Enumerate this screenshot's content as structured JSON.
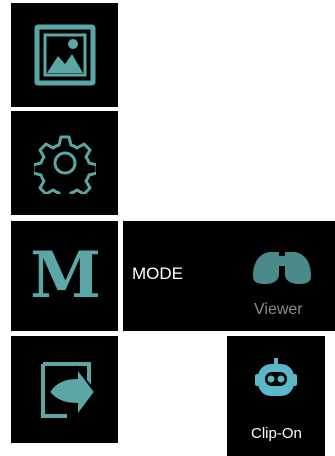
{
  "accent_color": "#5aa7a5",
  "menu": {
    "items": [
      {
        "name": "gallery",
        "icon": "image-icon"
      },
      {
        "name": "settings",
        "icon": "gear-icon"
      },
      {
        "name": "mode",
        "icon": "m-letter-icon",
        "glyph": "M"
      },
      {
        "name": "export",
        "icon": "export-arrow-icon"
      }
    ]
  },
  "mode_panel": {
    "label": "MODE",
    "options": [
      {
        "label": "Viewer",
        "icon": "binoculars-icon",
        "state": "dimmed"
      },
      {
        "label": "Clip-On",
        "icon": "robot-face-icon",
        "state": "active"
      }
    ]
  }
}
